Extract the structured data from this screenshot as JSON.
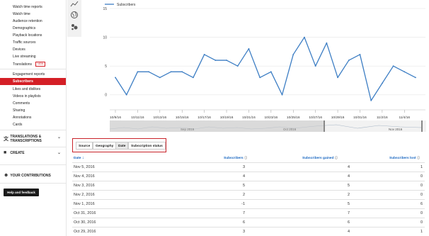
{
  "sidebar": {
    "items": [
      {
        "label": "Watch time reports"
      },
      {
        "label": "Watch time"
      },
      {
        "label": "Audience retention"
      },
      {
        "label": "Demographics"
      },
      {
        "label": "Playback locations"
      },
      {
        "label": "Traffic sources"
      },
      {
        "label": "Devices"
      },
      {
        "label": "Live streaming"
      },
      {
        "label": "Translations",
        "badge": "NEW"
      },
      {
        "label": "Engagement reports"
      },
      {
        "label": "Subscribers"
      },
      {
        "label": "Likes and dislikes"
      },
      {
        "label": "Videos in playlists"
      },
      {
        "label": "Comments"
      },
      {
        "label": "Sharing"
      },
      {
        "label": "Annotations"
      },
      {
        "label": "Cards"
      }
    ],
    "sections": {
      "translations": "TRANSLATIONS & TRANSCRIPTIONS",
      "create": "CREATE",
      "contributions": "YOUR CONTRIBUTIONS"
    },
    "help_button": "Help and feedback"
  },
  "chart_tools": [
    "line-chart-icon",
    "globe-icon",
    "bubble-chart-icon"
  ],
  "chart_data": {
    "type": "line",
    "legend": [
      "Subscribers"
    ],
    "series": [
      {
        "name": "Subscribers",
        "color": "#3d7ec4",
        "values": [
          3,
          0,
          4,
          4,
          3,
          4,
          4,
          3,
          7,
          6,
          6,
          5,
          8,
          3,
          4,
          0,
          7,
          10,
          5,
          9,
          3,
          6,
          7,
          -1,
          2,
          5,
          4,
          3
        ]
      }
    ],
    "x_tick_labels": [
      "10/9/16",
      "10/11/16",
      "10/13/16",
      "10/15/16",
      "10/17/16",
      "10/19/16",
      "10/21/16",
      "10/23/16",
      "10/25/16",
      "10/27/16",
      "10/29/16",
      "10/31/16",
      "11/2/16",
      "11/4/16"
    ],
    "y_ticks": [
      0,
      5,
      10,
      15
    ],
    "ylim": [
      -2,
      15
    ],
    "navigator_labels": [
      "Sep 2016",
      "Oct 2016",
      "Nov 2016"
    ],
    "grid": true,
    "legend_position": "top-left"
  },
  "tabs": [
    {
      "label": "Source",
      "selected": false
    },
    {
      "label": "Geography",
      "selected": false
    },
    {
      "label": "Date",
      "selected": true
    },
    {
      "label": "Subscription status",
      "selected": false
    }
  ],
  "table": {
    "columns": [
      "Date",
      "Subscribers",
      "Subscribers gained",
      "Subscribers lost"
    ],
    "sort_indicator": "↓",
    "rows": [
      {
        "date": "Nov 5, 2016",
        "subscribers": "3",
        "gained": "4",
        "lost": "1"
      },
      {
        "date": "Nov 4, 2016",
        "subscribers": "4",
        "gained": "4",
        "lost": "0"
      },
      {
        "date": "Nov 3, 2016",
        "subscribers": "5",
        "gained": "5",
        "lost": "0"
      },
      {
        "date": "Nov 2, 2016",
        "subscribers": "2",
        "gained": "2",
        "lost": "0"
      },
      {
        "date": "Nov 1, 2016",
        "subscribers": "-1",
        "gained": "5",
        "lost": "6"
      },
      {
        "date": "Oct 31, 2016",
        "subscribers": "7",
        "gained": "7",
        "lost": "0"
      },
      {
        "date": "Oct 30, 2016",
        "subscribers": "6",
        "gained": "6",
        "lost": "0"
      },
      {
        "date": "Oct 29, 2016",
        "subscribers": "3",
        "gained": "4",
        "lost": "1"
      }
    ]
  }
}
